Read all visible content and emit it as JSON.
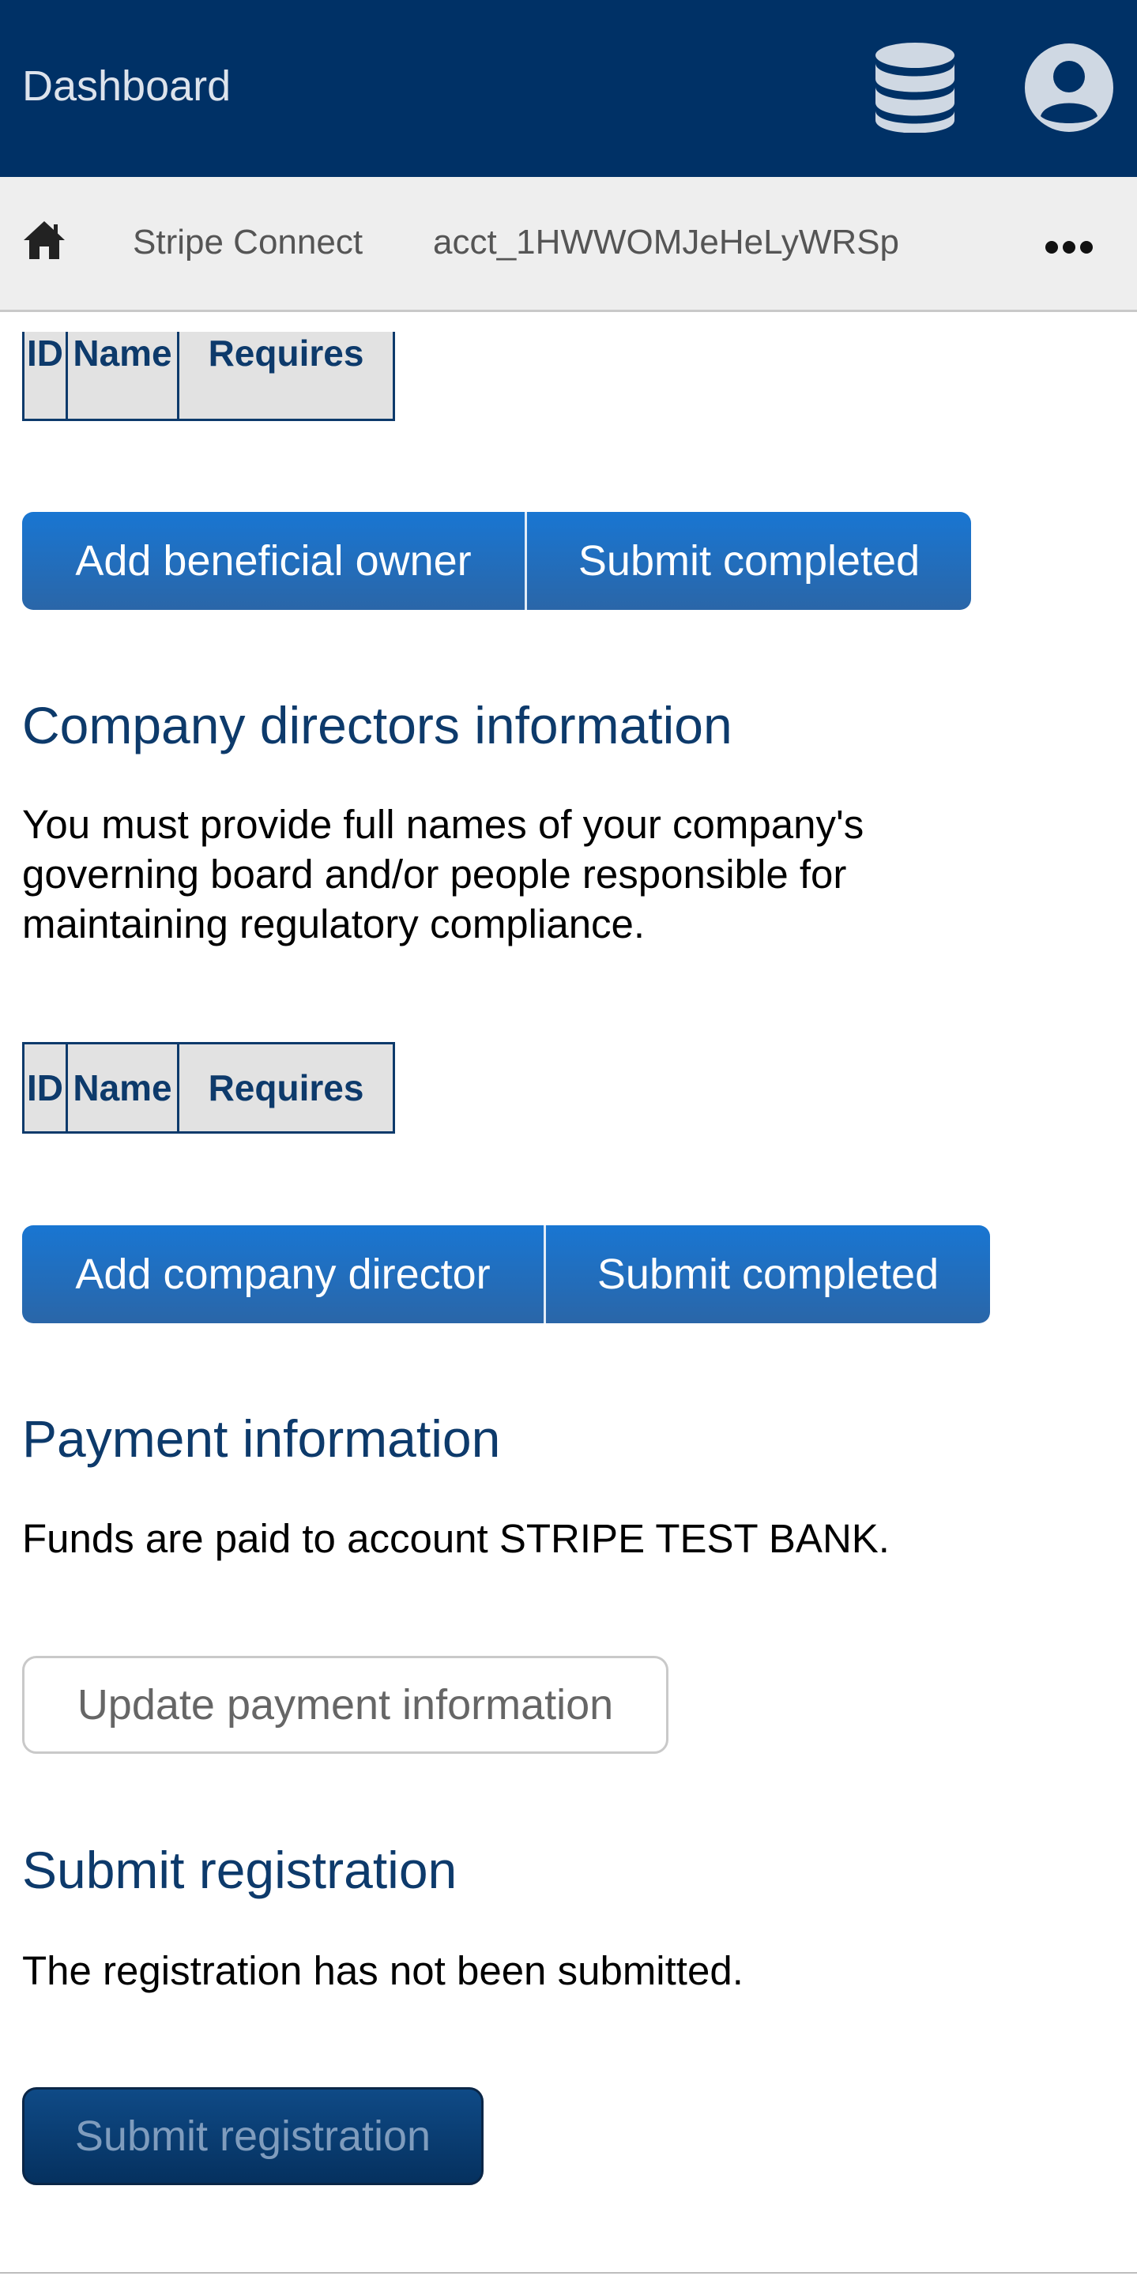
{
  "header": {
    "title": "Dashboard",
    "database_icon": "database-icon",
    "user_icon": "user-circle-icon"
  },
  "breadcrumb": {
    "home_icon": "home-icon",
    "items": [
      "Stripe Connect",
      "acct_1HWWOMJeHeLyWRSp"
    ],
    "more_icon": "more-horizontal-icon"
  },
  "owners": {
    "table_headers": [
      "ID",
      "Name",
      "Requires"
    ],
    "add_label": "Add beneficial owner",
    "submit_label": "Submit completed"
  },
  "directors": {
    "heading": "Company directors information",
    "description": "You must provide full names of your company's governing board and/or people responsible for maintaining regulatory compliance.",
    "table_headers": [
      "ID",
      "Name",
      "Requires"
    ],
    "add_label": "Add company director",
    "submit_label": "Submit completed"
  },
  "payment": {
    "heading": "Payment information",
    "description": "Funds are paid to account STRIPE TEST BANK.",
    "update_label": "Update payment information"
  },
  "registration": {
    "heading": "Submit registration",
    "status": "The registration has not been submitted.",
    "submit_label": "Submit registration"
  },
  "colors": {
    "header_bg": "#003166",
    "primary_button": "#1976d2",
    "heading_text": "#0d3a6b"
  }
}
